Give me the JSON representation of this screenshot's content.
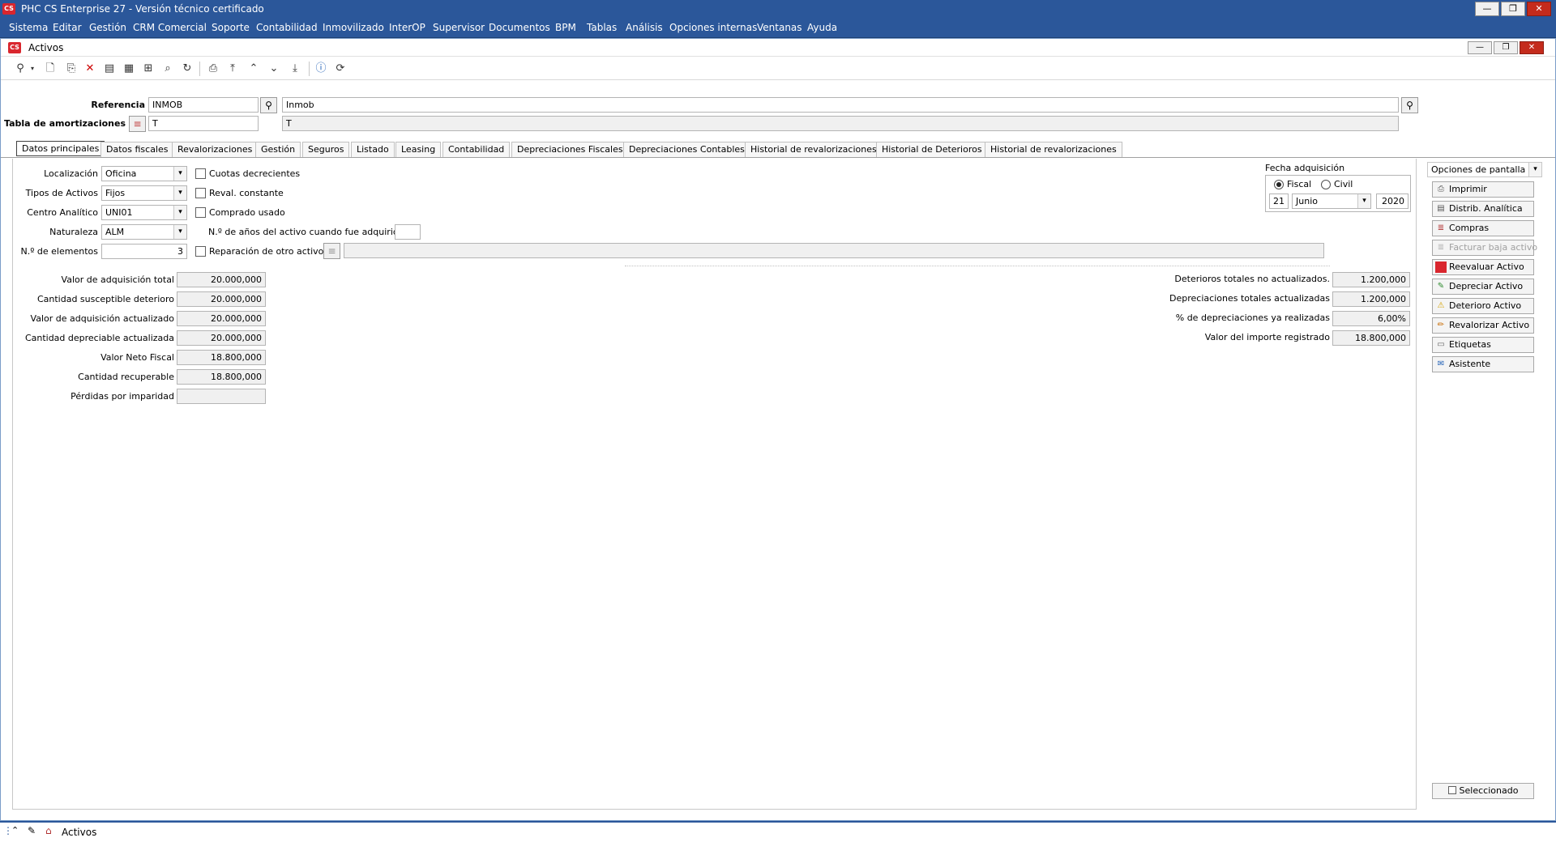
{
  "app": {
    "logo": "CS",
    "title": "PHC CS Enterprise 27 - Versión técnico certificado"
  },
  "menu": [
    "Sistema",
    "Editar",
    "Gestión",
    "CRM Comercial",
    "Soporte",
    "Contabilidad",
    "Inmovilizado",
    "InterOP",
    "Supervisor",
    "Documentos",
    "BPM",
    "Tablas",
    "Análisis",
    "Opciones internas",
    "Ventanas",
    "Ayuda"
  ],
  "window": {
    "title": "Activos"
  },
  "form": {
    "referencia_label": "Referencia",
    "referencia_value": "INMOB",
    "referencia_desc": "Inmob",
    "tabla_label": "Tabla de amortizaciones",
    "tabla_value": "T",
    "tabla_desc": "T"
  },
  "tabs": [
    "Datos principales",
    "Datos fiscales",
    "Revalorizaciones",
    "Gestión",
    "Seguros",
    "Listado",
    "Leasing",
    "Contabilidad",
    "Depreciaciones Fiscales",
    "Depreciaciones Contables",
    "Historial de revalorizaciones",
    "Historial de Deterioros",
    "Historial de revalorizaciones"
  ],
  "main": {
    "localizacion_label": "Localización",
    "localizacion_value": "Oficina",
    "tipos_label": "Tipos de Activos",
    "tipos_value": "Fijos",
    "centro_label": "Centro Analítico",
    "centro_value": "UNI01",
    "naturaleza_label": "Naturaleza",
    "naturaleza_value": "ALM",
    "elementos_label": "N.º de elementos",
    "elementos_value": "3",
    "cuotas_label": "Cuotas decrecientes",
    "reval_label": "Reval. constante",
    "comprado_label": "Comprado usado",
    "anos_label": "N.º de años del activo cuando fue adquirido",
    "reparacion_label": "Reparación de otro activo:"
  },
  "fecha": {
    "title": "Fecha adquisición",
    "fiscal": "Fiscal",
    "civil": "Civil",
    "day": "21",
    "month": "Junio",
    "year": "2020"
  },
  "values_left": [
    {
      "label": "Valor de adquisición total",
      "value": "20.000,000"
    },
    {
      "label": "Cantidad susceptible deterioro",
      "value": "20.000,000"
    },
    {
      "label": "Valor de adquisición actualizado",
      "value": "20.000,000"
    },
    {
      "label": "Cantidad depreciable actualizada",
      "value": "20.000,000"
    },
    {
      "label": "Valor Neto Fiscal",
      "value": "18.800,000"
    },
    {
      "label": "Cantidad recuperable",
      "value": "18.800,000"
    },
    {
      "label": "Pérdidas por imparidad",
      "value": ""
    }
  ],
  "values_right": [
    {
      "label": "Deterioros totales no actualizados.",
      "value": "1.200,000"
    },
    {
      "label": "Depreciaciones totales actualizadas",
      "value": "1.200,000"
    },
    {
      "label": "% de depreciaciones ya realizadas",
      "value": "6,00%"
    },
    {
      "label": "Valor del importe registrado",
      "value": "18.800,000"
    }
  ],
  "side": {
    "opciones": "Opciones de pantalla",
    "buttons": [
      "Imprimir",
      "Distrib. Analítica",
      "Compras",
      "Facturar baja activo",
      "Reevaluar Activo",
      "Depreciar Activo",
      "Deterioro Activo",
      "Revalorizar Activo",
      "Etiquetas",
      "Asistente"
    ],
    "seleccionado": "Seleccionado"
  },
  "status": {
    "tab": "Activos"
  },
  "colors": {
    "titlebar": "#2b579a",
    "close": "#c42b1c",
    "logo": "#d9262e"
  }
}
